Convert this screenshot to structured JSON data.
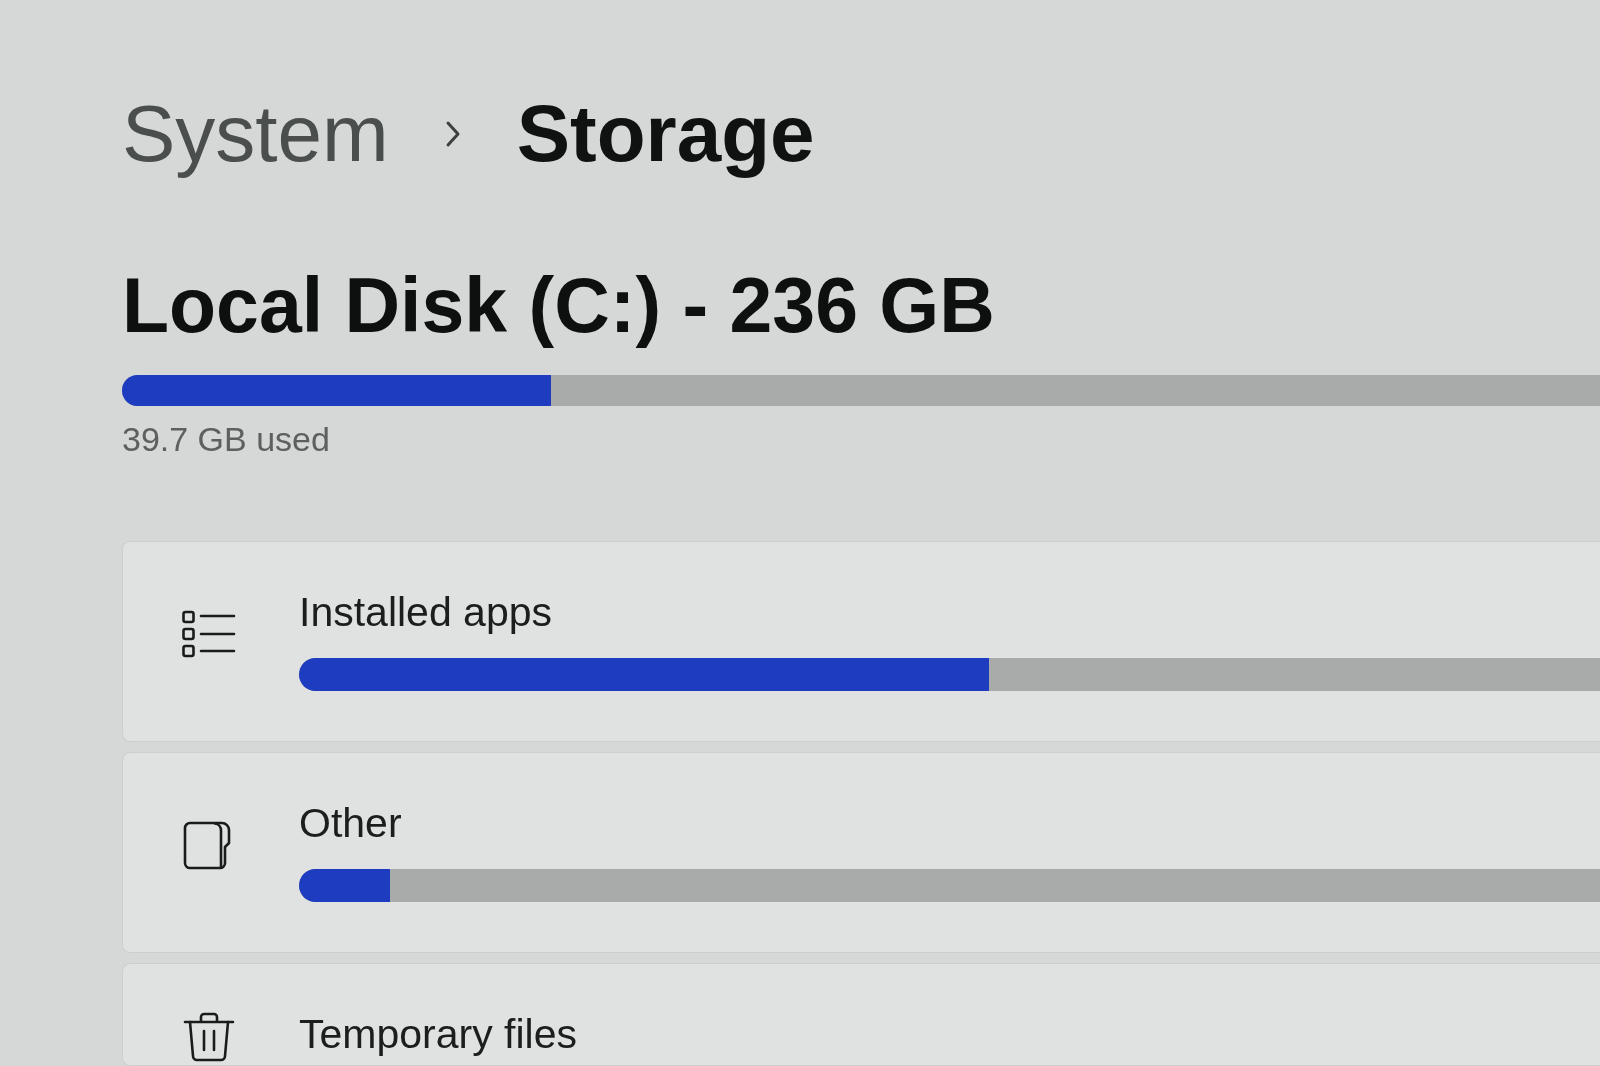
{
  "breadcrumb": [
    {
      "label": "System",
      "selected": false
    },
    {
      "label": "Storage",
      "selected": true
    }
  ],
  "drive": {
    "title": "Local Disk (C:) - 236 GB",
    "level": 0.29,
    "used": "39.7 GB used"
  },
  "categories": [
    {
      "kind": "apps",
      "label": "Installed apps",
      "level": 0.53
    },
    {
      "kind": "other",
      "label": "Other",
      "level": 0.07
    },
    {
      "kind": "temp",
      "label": "Temporary files"
    }
  ]
}
